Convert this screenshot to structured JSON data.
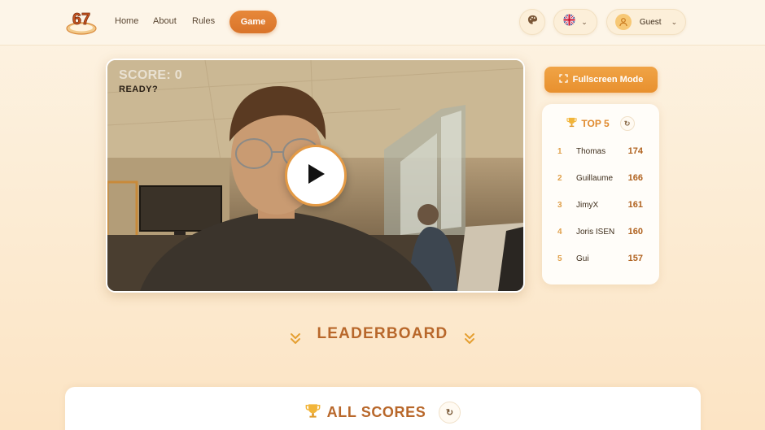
{
  "nav": {
    "logo_text": "67",
    "links": [
      "Home",
      "About",
      "Rules"
    ],
    "active": "Game",
    "language_flag": "uk-flag-icon",
    "user_label": "Guest"
  },
  "game": {
    "score_label": "SCORE: 0",
    "status": "READY?"
  },
  "sidebar": {
    "fullscreen_label": "Fullscreen Mode",
    "top_title": "TOP 5",
    "top5": [
      {
        "rank": "1",
        "name": "Thomas",
        "score": "174"
      },
      {
        "rank": "2",
        "name": "Guillaume",
        "score": "166"
      },
      {
        "rank": "3",
        "name": "JimyX",
        "score": "161"
      },
      {
        "rank": "4",
        "name": "Joris ISEN",
        "score": "160"
      },
      {
        "rank": "5",
        "name": "Gui",
        "score": "157"
      }
    ]
  },
  "leaderboard": {
    "heading": "LEADERBOARD",
    "all_scores_title": "ALL SCORES"
  },
  "colors": {
    "accent": "#e8902e",
    "accent_dark": "#b8672a",
    "background": "#fdf3e3"
  }
}
